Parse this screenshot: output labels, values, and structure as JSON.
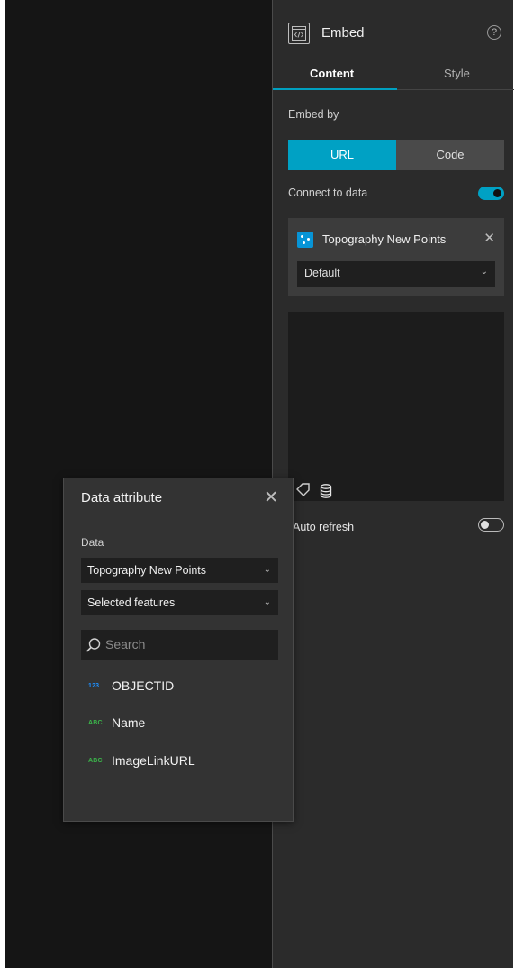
{
  "panel": {
    "title": "Embed",
    "help_glyph": "?",
    "tabs": [
      {
        "label": "Content",
        "active": true
      },
      {
        "label": "Style",
        "active": false
      }
    ],
    "embed_by_label": "Embed by",
    "embed_options": [
      {
        "label": "URL",
        "selected": true
      },
      {
        "label": "Code",
        "selected": false
      }
    ],
    "connect_to_data_label": "Connect to data",
    "connect_to_data_on": true,
    "data_source": {
      "name": "Topography New Points",
      "view": "Default"
    },
    "auto_refresh_label": "Auto refresh",
    "auto_refresh_on": false
  },
  "popup": {
    "title": "Data attribute",
    "data_label": "Data",
    "data_source_value": "Topography New Points",
    "selection_value": "Selected features",
    "search_placeholder": "Search",
    "fields": [
      {
        "type_badge": "123",
        "name": "OBJECTID",
        "kind": "number"
      },
      {
        "type_badge": "ABC",
        "name": "Name",
        "kind": "string"
      },
      {
        "type_badge": "ABC",
        "name": "ImageLinkURL",
        "kind": "string"
      }
    ]
  },
  "colors": {
    "accent": "#00a1c4",
    "layer_icon": "#0794d6",
    "number_badge": "#1e90ff",
    "string_badge": "#3bb54a"
  }
}
